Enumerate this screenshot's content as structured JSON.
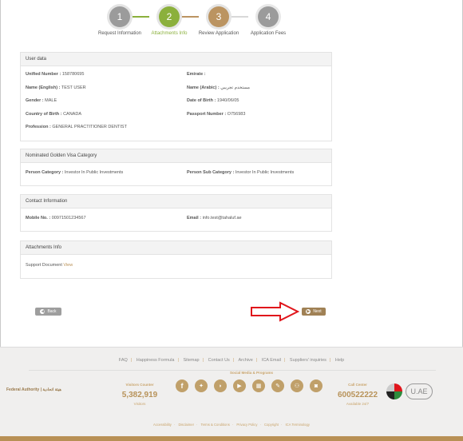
{
  "stepper": {
    "steps": [
      {
        "num": "1",
        "label": "Request Information",
        "state": "done"
      },
      {
        "num": "2",
        "label": "Attachments Info",
        "state": "active"
      },
      {
        "num": "3",
        "label": "Review Application",
        "state": "pending"
      },
      {
        "num": "4",
        "label": "Application Fees",
        "state": "pending"
      }
    ]
  },
  "user_data": {
    "title": "User data",
    "unified_number_label": "Unified Number :",
    "unified_number": "158780695",
    "emirate_label": "Emirate :",
    "emirate": "",
    "name_en_label": "Name (English) :",
    "name_en": "TEST USER",
    "name_ar_label": "Name (Arabic) :",
    "name_ar": "مستخدم تجريبي",
    "gender_label": "Gender :",
    "gender": "MALE",
    "dob_label": "Date of Birth :",
    "dob": "1940/06/05",
    "country_label": "Country of Birth :",
    "country": "CANADA",
    "passport_label": "Passport Number :",
    "passport": "O756983",
    "profession_label": "Profession :",
    "profession": "GENERAL PRACTITIONER DENTIST"
  },
  "category": {
    "title": "Nominated Golden Visa Category",
    "person_category_label": "Person Category :",
    "person_category": "Investor In Public Investments",
    "person_sub_label": "Person Sub Category :",
    "person_sub": "Investor In Public Investments"
  },
  "contact": {
    "title": "Contact Information",
    "mobile_label": "Mobile No. :",
    "mobile": "00971501234567",
    "email_label": "Email :",
    "email": "info.test@tahaluf.ae"
  },
  "attachments": {
    "title": "Attachments Info",
    "support_label": "Support Document",
    "view_label": "View"
  },
  "buttons": {
    "back": "Back",
    "next": "Next"
  },
  "footer": {
    "links": [
      "FAQ",
      "Happiness Formula",
      "Sitemap",
      "Contact Us",
      "Archive",
      "ICA Email",
      "Suppliers' inquiries",
      "Help"
    ],
    "visitors_caption": "Visitors Counter",
    "visitors_count": "5,382,919",
    "visitors_label": "Visitors",
    "social_caption": "Social Media & Programs",
    "call_caption": "Call Center",
    "call_number": "600522222",
    "call_hours": "Available 24/7",
    "authority": "Federal Authority | هيئة اتحادية",
    "uae_logo_text": "U.AE",
    "bottom_links": [
      "Accessibility",
      "Disclaimer",
      "Terms & Conditions",
      "Privacy Policy",
      "Copyright",
      "ICA Terminology"
    ]
  },
  "colors": {
    "done": "#9b9b9b",
    "active": "#8bb03c",
    "pending": "#bb9461",
    "next": "#a08155",
    "back": "#9e9e9e",
    "arrow": "#e0151b"
  }
}
